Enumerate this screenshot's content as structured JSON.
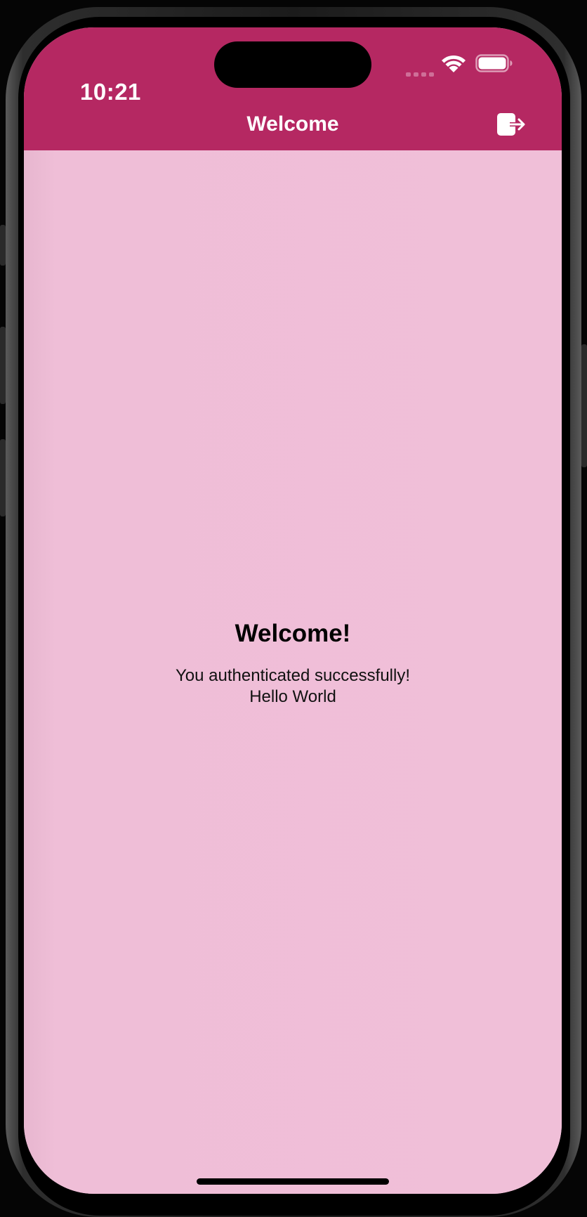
{
  "status_bar": {
    "time": "10:21",
    "wifi_icon": "wifi-icon",
    "battery_icon": "battery-icon",
    "signal_icon": "cellular-signal-icon"
  },
  "nav_bar": {
    "title": "Welcome",
    "logout_icon": "logout-icon"
  },
  "main": {
    "heading": "Welcome!",
    "message": "You authenticated successfully!",
    "greeting": "Hello World"
  },
  "colors": {
    "header_background": "#b52862",
    "content_background": "#f0bfd8",
    "text_primary": "#000000",
    "header_text": "#ffffff"
  }
}
